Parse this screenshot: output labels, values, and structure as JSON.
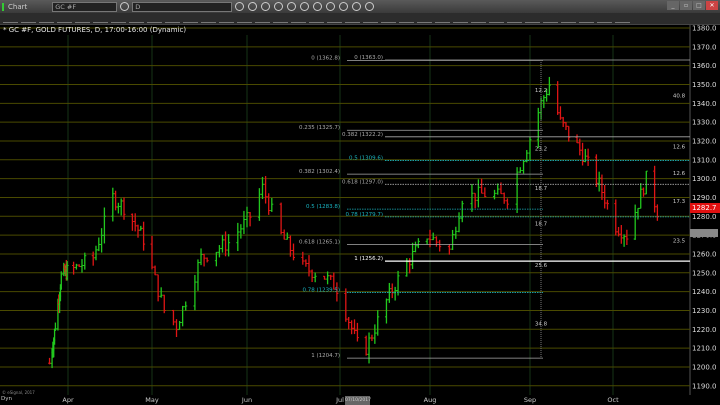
{
  "window": {
    "app_label": "Chart",
    "symbol": "GC #F",
    "interval": "D",
    "buttons": [
      "minimize",
      "restore",
      "maximize",
      "close"
    ]
  },
  "header_icons": [
    "crosshair-icon",
    "clock-icon",
    "pencil-icon",
    "gauge-icon",
    "message-icon",
    "play-icon",
    "globe-icon",
    "link-icon",
    "chat-icon",
    "twitter-icon",
    "facebook-icon"
  ],
  "toolbar_icons": [
    "line",
    "hline",
    "vline",
    "trendline",
    "pitchfork",
    "fib",
    "gann",
    "ellipse",
    "rectangle",
    "pencil",
    "triangle",
    "channel",
    "hhf",
    "parallel",
    "circle-grid",
    "fib-fan",
    "fib-time",
    "cycle",
    "levels",
    "gaps",
    "regression",
    "text",
    "arrow-up",
    "arrow-down",
    "box",
    "angle",
    "speed",
    "grid",
    "bars",
    "eye",
    "dots",
    "wave",
    "link",
    "comment",
    "magnet"
  ],
  "chart": {
    "title": "* GC #F, GOLD FUTURES, D, 17:00-16:00 (Dynamic)",
    "copyright": "© eSignal, 2017",
    "dyn_label": "Dyn",
    "date_tag": "07/10/2017",
    "last_price": "1282.7",
    "colors": {
      "up": "#22c81e",
      "down": "#e01515",
      "grid": "#4a4a00",
      "fib": "#aaaaaa",
      "fib_cyan": "#19b3c0",
      "bg": "#000000"
    },
    "y_axis": {
      "min": 1190,
      "max": 1380,
      "step": 10,
      "labels": [
        "1380.0",
        "1370.0",
        "1360.0",
        "1350.0",
        "1340.0",
        "1330.0",
        "1320.0",
        "1310.0",
        "1300.0",
        "1290.0",
        "1280.0",
        "1270.0",
        "1260.0",
        "1250.0",
        "1240.0",
        "1230.0",
        "1220.0",
        "1210.0",
        "1200.0",
        "1190.0"
      ]
    },
    "x_axis": {
      "months": [
        {
          "label": "Apr",
          "date": "2017-04-01"
        },
        {
          "label": "May",
          "date": "2017-05-01"
        },
        {
          "label": "Jun",
          "date": "2017-06-01"
        },
        {
          "label": "Jul",
          "date": "2017-07-01"
        },
        {
          "label": "Aug",
          "date": "2017-08-01"
        },
        {
          "label": "Sep",
          "date": "2017-09-01"
        },
        {
          "label": "Oct",
          "date": "2017-10-01"
        }
      ]
    },
    "price_path": [
      [
        "2017-03-10",
        1202
      ],
      [
        "2017-03-15",
        1215
      ],
      [
        "2017-03-24",
        1248
      ],
      [
        "2017-04-03",
        1252
      ],
      [
        "2017-04-10",
        1258
      ],
      [
        "2017-04-17",
        1290
      ],
      [
        "2017-04-21",
        1285
      ],
      [
        "2017-04-28",
        1268
      ],
      [
        "2017-05-05",
        1230
      ],
      [
        "2017-05-09",
        1222
      ],
      [
        "2017-05-17",
        1258
      ],
      [
        "2017-05-26",
        1266
      ],
      [
        "2017-06-02",
        1280
      ],
      [
        "2017-06-06",
        1295
      ],
      [
        "2017-06-12",
        1270
      ],
      [
        "2017-06-19",
        1253
      ],
      [
        "2017-06-26",
        1248
      ],
      [
        "2017-06-30",
        1242
      ],
      [
        "2017-07-07",
        1212
      ],
      [
        "2017-07-10",
        1210
      ],
      [
        "2017-07-17",
        1235
      ],
      [
        "2017-07-24",
        1255
      ],
      [
        "2017-07-31",
        1270
      ],
      [
        "2017-08-07",
        1262
      ],
      [
        "2017-08-11",
        1290
      ],
      [
        "2017-08-18",
        1292
      ],
      [
        "2017-08-25",
        1290
      ],
      [
        "2017-08-30",
        1312
      ],
      [
        "2017-09-05",
        1340
      ],
      [
        "2017-09-08",
        1350
      ],
      [
        "2017-09-12",
        1330
      ],
      [
        "2017-09-20",
        1313
      ],
      [
        "2017-09-26",
        1297
      ],
      [
        "2017-10-02",
        1275
      ],
      [
        "2017-10-06",
        1270
      ],
      [
        "2017-10-13",
        1300
      ],
      [
        "2017-10-17",
        1283
      ]
    ],
    "fib_sets": [
      {
        "levels": [
          {
            "label": "0 (1362.8)",
            "price": 1362.8,
            "cyan": false
          },
          {
            "label": "0.235 (1325.7)",
            "price": 1325.7,
            "cyan": false
          },
          {
            "label": "0.382 (1302.4)",
            "price": 1302.4,
            "cyan": false
          },
          {
            "label": "0.5 (1283.8)",
            "price": 1283.8,
            "cyan": true
          },
          {
            "label": "0.618 (1265.1)",
            "price": 1265.1,
            "cyan": false
          },
          {
            "label": "0.78 (1239.5)",
            "price": 1239.5,
            "cyan": true
          },
          {
            "label": "1 (1204.7)",
            "price": 1204.7,
            "cyan": false
          }
        ]
      },
      {
        "levels": [
          {
            "label": "0 (1363.0)",
            "price": 1363.0,
            "cyan": false
          },
          {
            "label": "0.382 (1322.2)",
            "price": 1322.2,
            "cyan": false
          },
          {
            "label": "0.5 (1309.6)",
            "price": 1309.6,
            "cyan": true
          },
          {
            "label": "0.618 (1297.0)",
            "price": 1297.0,
            "cyan": false
          },
          {
            "label": "0.78 (1279.7)",
            "price": 1279.7,
            "cyan": true
          },
          {
            "label": "1 (1256.2)",
            "price": 1256.2,
            "cyan": false
          }
        ]
      }
    ],
    "distance_labels_mid": [
      {
        "text": "12.2",
        "price": 1346
      },
      {
        "text": "23.2",
        "price": 1315
      },
      {
        "text": "18.7",
        "price": 1294
      },
      {
        "text": "18.7",
        "price": 1275
      },
      {
        "text": "25.6",
        "price": 1253
      },
      {
        "text": "34.8",
        "price": 1222
      }
    ],
    "distance_labels_right": [
      {
        "text": "40.8",
        "price": 1343
      },
      {
        "text": "12.6",
        "price": 1316
      },
      {
        "text": "12.6",
        "price": 1302
      },
      {
        "text": "17.3",
        "price": 1287
      },
      {
        "text": "23.5",
        "price": 1266
      }
    ]
  }
}
